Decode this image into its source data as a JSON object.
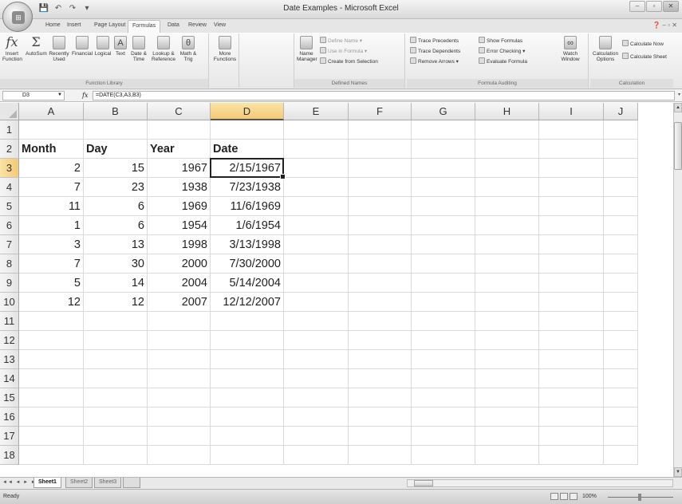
{
  "window": {
    "title": "Date Examples - Microsoft Excel",
    "controls": [
      "–",
      "▫",
      "✕"
    ]
  },
  "office_button": {
    "logo": "⊞"
  },
  "quick_access": [
    "💾",
    "↶",
    "↷",
    "▾"
  ],
  "ribbon_tabs": [
    {
      "label": "Home"
    },
    {
      "label": "Insert"
    },
    {
      "label": "Page Layout"
    },
    {
      "label": "Formulas",
      "active": true
    },
    {
      "label": "Data"
    },
    {
      "label": "Review"
    },
    {
      "label": "View"
    }
  ],
  "ribbon": {
    "function_library": {
      "label": "Function Library",
      "insert_function": "Insert Function",
      "buttons": [
        "AutoSum",
        "Recently Used",
        "Financial",
        "Logical",
        "Text",
        "Date & Time",
        "Lookup & Reference",
        "Math & Trig",
        "More Functions"
      ]
    },
    "defined_names": {
      "label": "Defined Names",
      "name_manager": "Name Manager",
      "define_name": "Define Name",
      "use_in_formula": "Use in Formula",
      "create_from_selection": "Create from Selection"
    },
    "formula_auditing": {
      "label": "Formula Auditing",
      "trace_precedents": "Trace Precedents",
      "trace_dependents": "Trace Dependents",
      "remove_arrows": "Remove Arrows",
      "show_formulas": "Show Formulas",
      "error_checking": "Error Checking",
      "evaluate_formula": "Evaluate Formula",
      "watch_window": "Watch Window"
    },
    "calculation": {
      "label": "Calculation",
      "calculation_options": "Calculation Options",
      "calculate_now": "Calculate Now",
      "calculate_sheet": "Calculate Sheet"
    }
  },
  "formula_bar": {
    "name_box": "D3",
    "fx": "fx",
    "formula": "=DATE(C3,A3,B3)"
  },
  "columns": [
    "A",
    "B",
    "C",
    "D",
    "E",
    "F",
    "G",
    "H",
    "I",
    "J"
  ],
  "rows": [
    "1",
    "2",
    "3",
    "4",
    "5",
    "6",
    "7",
    "8",
    "9",
    "10",
    "11",
    "12",
    "13",
    "14",
    "15",
    "16",
    "17",
    "18"
  ],
  "table": {
    "headers": [
      "Month",
      "Day",
      "Year",
      "Date"
    ],
    "data": [
      [
        "2",
        "15",
        "1967",
        "2/15/1967"
      ],
      [
        "7",
        "23",
        "1938",
        "7/23/1938"
      ],
      [
        "11",
        "6",
        "1969",
        "11/6/1969"
      ],
      [
        "1",
        "6",
        "1954",
        "1/6/1954"
      ],
      [
        "3",
        "13",
        "1998",
        "3/13/1998"
      ],
      [
        "7",
        "30",
        "2000",
        "7/30/2000"
      ],
      [
        "5",
        "14",
        "2004",
        "5/14/2004"
      ],
      [
        "12",
        "12",
        "2007",
        "12/12/2007"
      ]
    ]
  },
  "active_cell": "D3",
  "sheet_tabs": [
    {
      "label": "Sheet1",
      "active": true
    },
    {
      "label": "Sheet2"
    },
    {
      "label": "Sheet3"
    }
  ],
  "status": {
    "ready": "Ready",
    "zoom": "100%"
  }
}
